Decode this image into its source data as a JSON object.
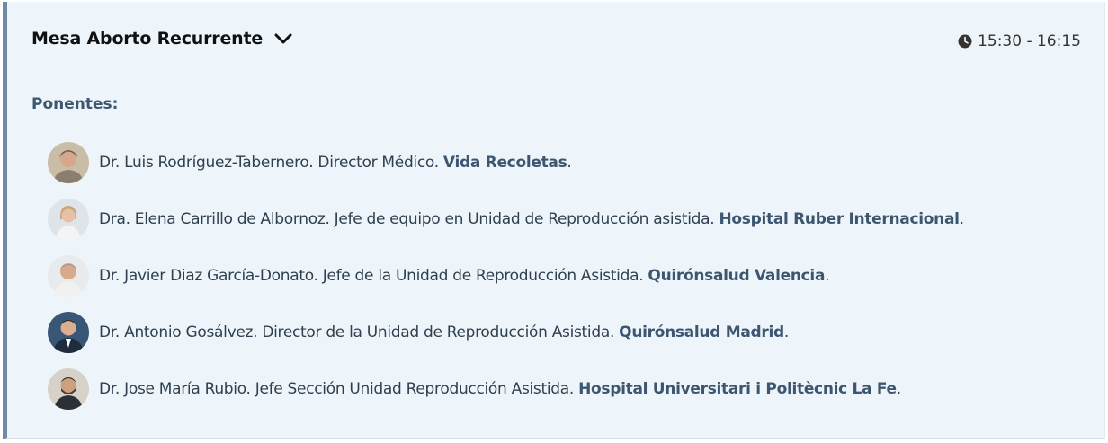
{
  "session": {
    "title": "Mesa Aborto Recurrente",
    "toggle_icon": "chevron-down-icon",
    "time_icon": "clock-icon",
    "time": "15:30 - 16:15",
    "speakers_heading": "Ponentes:",
    "colors": {
      "card_background": "#eef5fa",
      "accent_border": "#6e8aa8",
      "heading": "#3d5670",
      "title": "#111111"
    },
    "speakers": [
      {
        "avatar": "speaker-photo",
        "text": "Dr. Luis Rodríguez-Tabernero. Director Médico.",
        "org": "Vida Recoletas",
        "suffix": "."
      },
      {
        "avatar": "speaker-photo",
        "text": "Dra. Elena Carrillo de Albornoz. Jefe de equipo en Unidad de Reproducción asistida.",
        "org": "Hospital Ruber Internacional",
        "suffix": "."
      },
      {
        "avatar": "speaker-photo",
        "text": "Dr. Javier Diaz García-Donato. Jefe de la Unidad de Reproducción Asistida.",
        "org": "Quirónsalud Valencia",
        "suffix": "."
      },
      {
        "avatar": "speaker-photo",
        "text": "Dr. Antonio Gosálvez. Director de la Unidad de Reproducción Asistida.",
        "org": "Quirónsalud Madrid",
        "suffix": "."
      },
      {
        "avatar": "speaker-photo",
        "text": "Dr. Jose María Rubio. Jefe Sección Unidad Reproducción Asistida.",
        "org": "Hospital Universitari i Politècnic La Fe",
        "suffix": "."
      }
    ]
  }
}
